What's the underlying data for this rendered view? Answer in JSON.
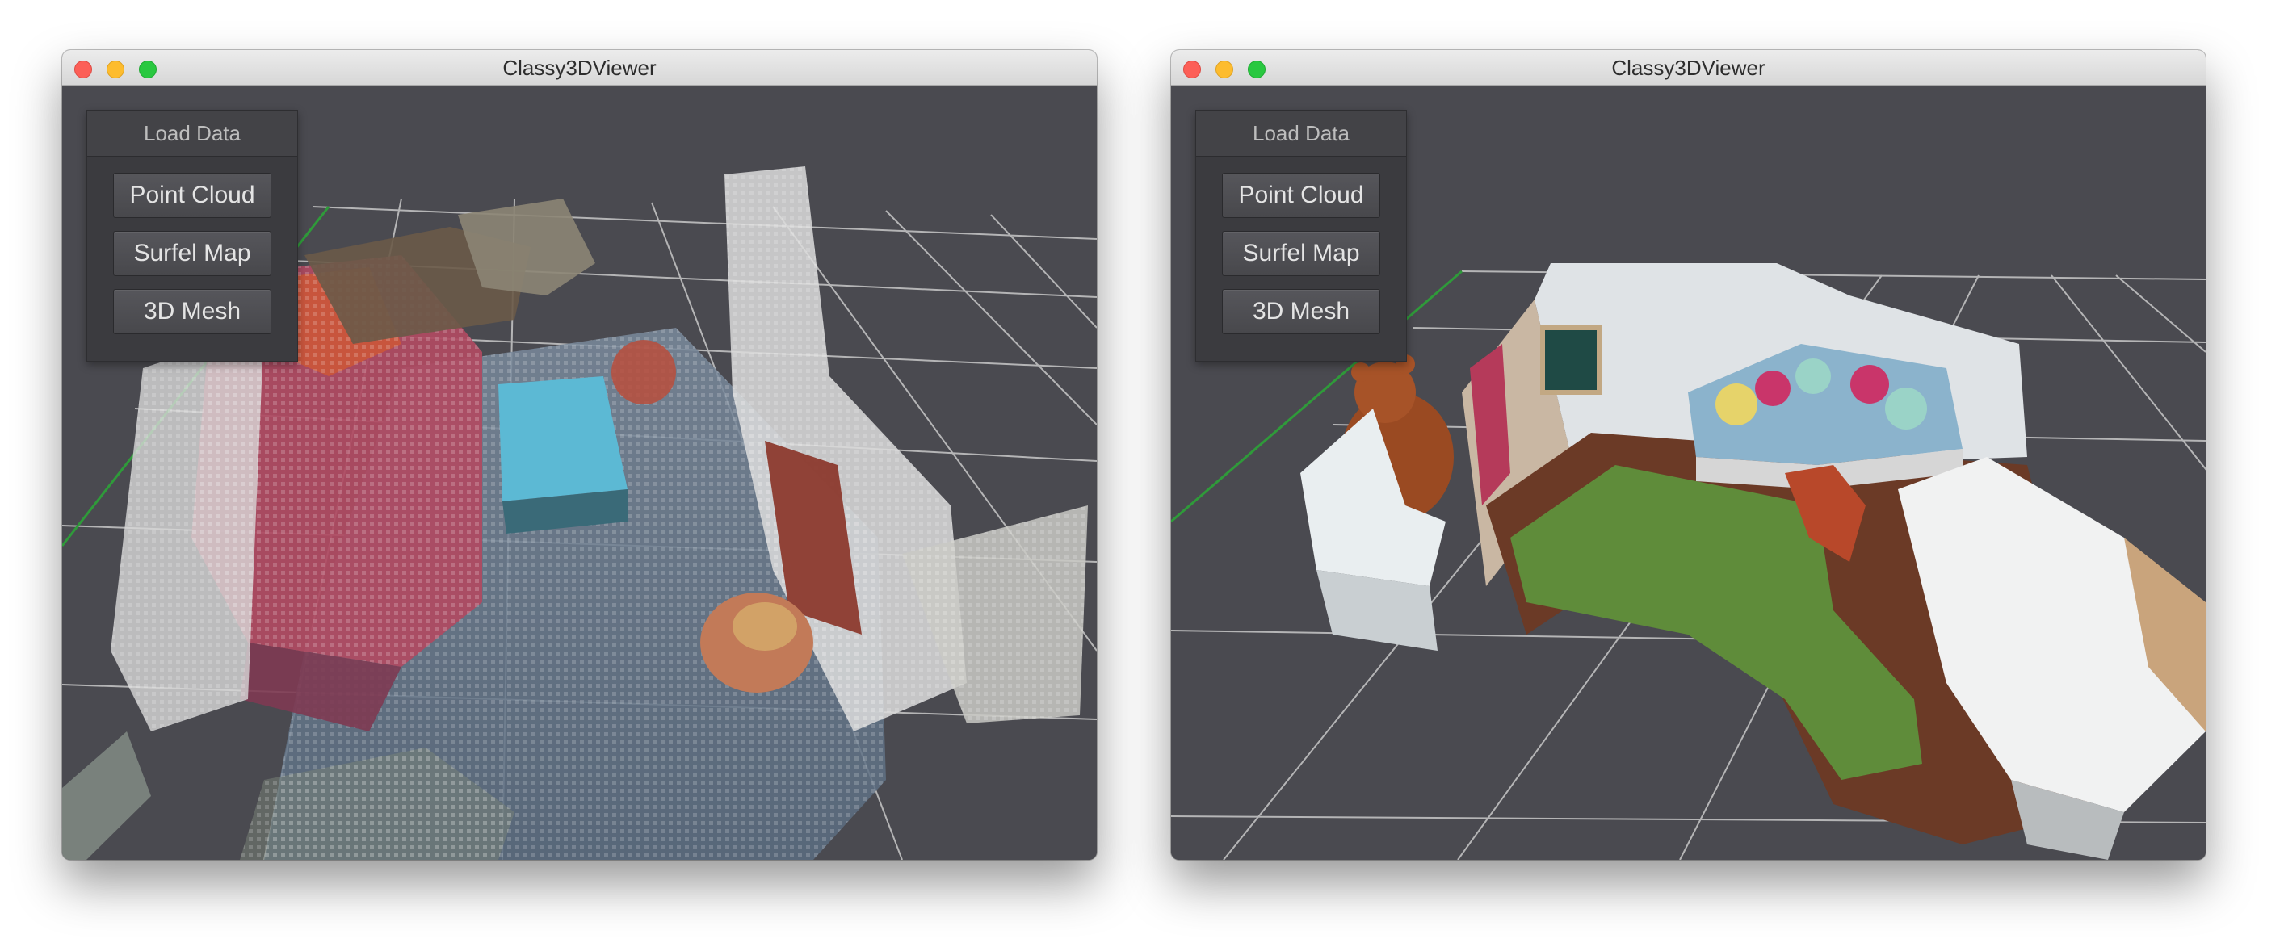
{
  "windows": [
    {
      "title": "Classy3DViewer",
      "panel": {
        "header": "Load Data",
        "buttons": [
          "Point Cloud",
          "Surfel Map",
          "3D Mesh"
        ]
      }
    },
    {
      "title": "Classy3DViewer",
      "panel": {
        "header": "Load Data",
        "buttons": [
          "Point Cloud",
          "Surfel Map",
          "3D Mesh"
        ]
      }
    }
  ],
  "colors": {
    "viewport_bg": "#4a4a50",
    "grid_line": "#c8c8c8",
    "axis_green": "#2f9a3a",
    "close": "#fc5f57",
    "minimize": "#fdbc2e",
    "maximize": "#29c840"
  },
  "icons": {
    "close": "close-traffic-light-icon",
    "minimize": "minimize-traffic-light-icon",
    "maximize": "maximize-traffic-light-icon"
  }
}
